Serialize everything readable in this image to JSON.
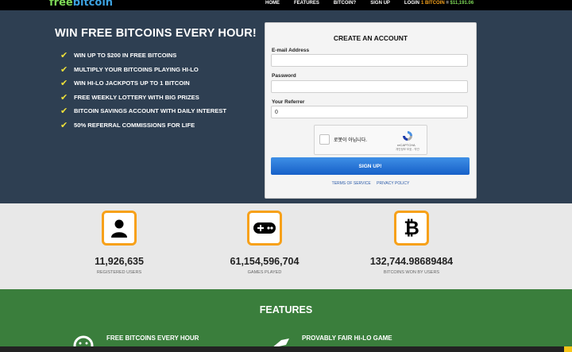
{
  "nav": {
    "logo_free": "free",
    "logo_bitcoin": "bitcoin",
    "items": [
      "HOME",
      "FEATURES",
      "BITCOIN?",
      "SIGN UP",
      "LOGIN"
    ],
    "price_prefix": "1 BITCOIN",
    "price_eq": " = ",
    "price_value": "$11,191.06"
  },
  "hero": {
    "title": "WIN FREE BITCOINS EVERY HOUR!",
    "perks": [
      "WIN UP TO $200 IN FREE BITCOINS",
      "MULTIPLY YOUR BITCOINS PLAYING HI-LO",
      "WIN HI-LO JACKPOTS UP TO 1 BITCOIN",
      "FREE WEEKLY LOTTERY WITH BIG PRIZES",
      "BITCOIN SAVINGS ACCOUNT WITH DAILY INTEREST",
      "50% REFERRAL COMMISSIONS FOR LIFE"
    ]
  },
  "form": {
    "title": "CREATE AN ACCOUNT",
    "email_label": "E-mail Address",
    "email_value": "",
    "password_label": "Password",
    "password_value": "",
    "referrer_label": "Your Referrer",
    "referrer_value": "0",
    "captcha_text": "로봇이 아닙니다.",
    "captcha_brand": "reCAPTCHA",
    "captcha_links": "개인정보 보호 - 약관",
    "signup_label": "SIGN UP!",
    "terms_link": "TERMS OF SERVICE",
    "privacy_link": "PRIVACY POLICY"
  },
  "stats": [
    {
      "value": "11,926,635",
      "caption": "REGISTERED USERS",
      "icon": "user-icon"
    },
    {
      "value": "61,154,596,704",
      "caption": "GAMES PLAYED",
      "icon": "gamepad-icon"
    },
    {
      "value": "132,744.98689484",
      "caption": "BITCOINS WON BY USERS",
      "icon": "bitcoin-icon"
    }
  ],
  "features": {
    "title": "FEATURES",
    "items": [
      "FREE BITCOINS EVERY HOUR",
      "PROVABLY FAIR HI-LO GAME"
    ]
  },
  "colors": {
    "accent": "#f7a11a",
    "hero_bg": "#2e3f52",
    "features_bg": "#3a7e3c",
    "button": "#1f6fd6"
  }
}
